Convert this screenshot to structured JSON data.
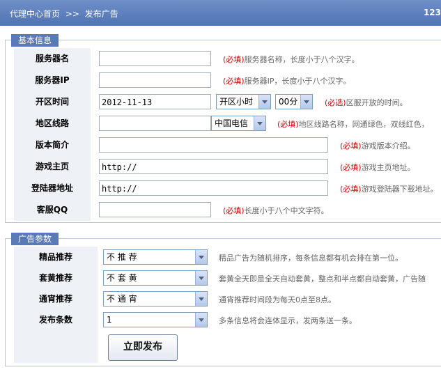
{
  "header": {
    "crumb_home": "代理中心首页",
    "crumb_sep": ">>",
    "crumb_current": "发布广告",
    "right_text": "123"
  },
  "basic": {
    "legend": "基本信息",
    "server_name": {
      "label": "服务器名",
      "value": "",
      "hint_tag": "(必填)",
      "hint": "服务器名称，长度小于八个汉字。"
    },
    "server_ip": {
      "label": "服务器IP",
      "value": "",
      "hint_tag": "(必填)",
      "hint": "服务器IP，长度小于八个汉字。"
    },
    "open_time": {
      "label": "开区时间",
      "value": "2012-11-13",
      "hour": "开区小时",
      "minute": "00分",
      "hint_tag": "(必选)",
      "hint": "区服开放的时间。"
    },
    "region": {
      "label": "地区线路",
      "value": "",
      "select": "中国电信",
      "hint_tag": "(必填)",
      "hint": "地区线路名称，网通绿色，双线红色，"
    },
    "version": {
      "label": "版本简介",
      "value": "",
      "hint_tag": "(必填)",
      "hint": "游戏版本介绍。"
    },
    "homepage": {
      "label": "游戏主页",
      "value": "http://",
      "hint_tag": "(必填)",
      "hint": "游戏主页地址。"
    },
    "launcher": {
      "label": "登陆器地址",
      "value": "http://",
      "hint_tag": "(必填)",
      "hint": "游戏登陆器下载地址。"
    },
    "qq": {
      "label": "客服QQ",
      "value": "",
      "hint_tag": "(必填)",
      "hint": "长度小于八个中文字符。"
    }
  },
  "ad": {
    "legend": "广告参数",
    "featured": {
      "label": "精品推荐",
      "select": "不 推 荐",
      "hint": "精品广告为随机排序，每条信息都有机会排在第一位。"
    },
    "yellow": {
      "label": "套黄推荐",
      "select": "不 套 黄",
      "hint": "套黄全天即是全天自动套黄，整点和半点都自动套黄，广告随"
    },
    "overnight": {
      "label": "通宵推荐",
      "select": "不 通 宵",
      "hint": "通宵推荐时间段为每天0点至8点。"
    },
    "count": {
      "label": "发布条数",
      "select": "1",
      "hint": "多条信息将会连体显示，发两条送一条。"
    },
    "submit": "立即发布"
  }
}
